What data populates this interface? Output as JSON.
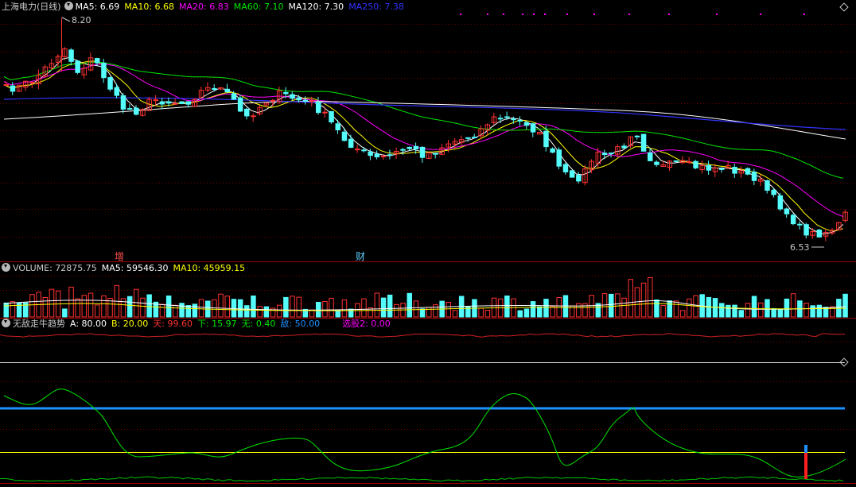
{
  "header": {
    "stock_title": "上海电力(日线)",
    "ma5_label": "MA5: 6.69",
    "ma10_label": "MA10: 6.68",
    "ma20_label": "MA20: 6.83",
    "ma60_label": "MA60: 7.10",
    "ma120_label": "MA120: 7.30",
    "ma250_label": "MA250: 7.38"
  },
  "price_panel": {
    "high_annotation": "8.20",
    "low_annotation": "6.53",
    "marker_zeng": "增",
    "marker_cai": "财"
  },
  "volume_panel": {
    "volume_label": "VOLUME: 72875.75",
    "ma5_label": "MA5: 59546.30",
    "ma10_label": "MA10: 45959.15"
  },
  "indicator_panel": {
    "name": "无敌走牛趋势",
    "a_label": "A: 80.00",
    "b_label": "B: 20.00",
    "tian_label": "天: 99.60",
    "xia_label": "下: 15.97",
    "wu_label": "无: 0.40",
    "di_label": "敌: 50.00",
    "xuangu_label": "选股2: 0.00"
  },
  "colors": {
    "up": "#ff3232",
    "down": "#54fcfc",
    "ma5": "#ffffff",
    "ma10": "#ffff00",
    "ma20": "#ff00ff",
    "ma60": "#00e600",
    "ma120": "#ffffff",
    "ma250": "#3333ff",
    "grid": "#7a0000"
  }
}
